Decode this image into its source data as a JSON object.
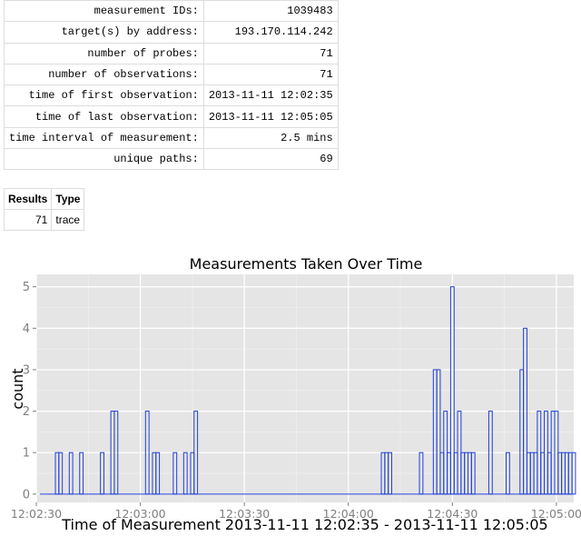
{
  "summary": {
    "rows": [
      {
        "key": "measurement IDs:",
        "value": "1039483"
      },
      {
        "key": "target(s) by address:",
        "value": "193.170.114.242"
      },
      {
        "key": "number of probes:",
        "value": "71"
      },
      {
        "key": "number of observations:",
        "value": "71"
      },
      {
        "key": "time of first observation:",
        "value": "2013-11-11 12:02:35"
      },
      {
        "key": "time of last observation:",
        "value": "2013-11-11 12:05:05"
      },
      {
        "key": "time interval of measurement:",
        "value": "2.5 mins"
      },
      {
        "key": "unique paths:",
        "value": "69"
      }
    ]
  },
  "results": {
    "headers": [
      "Results",
      "Type"
    ],
    "rows": [
      {
        "count": "71",
        "type": "trace"
      }
    ]
  },
  "chart_data": {
    "type": "bar",
    "title": "Measurements Taken Over Time",
    "xlabel": "Time of Measurement 2013-11-11 12:02:35 - 2013-11-11 12:05:05",
    "ylabel": "count",
    "ylim": [
      0,
      5
    ],
    "yticks": [
      0,
      1,
      2,
      3,
      4,
      5
    ],
    "xlim": [
      "12:02:30",
      "12:05:05"
    ],
    "xticks": [
      "12:02:30",
      "12:03:00",
      "12:03:30",
      "12:04:00",
      "12:04:30",
      "12:05:00"
    ],
    "grid": true,
    "bar_color": "#1f3fd6",
    "panel_color": "#e5e5e5",
    "series": [
      {
        "x": [
          "12:02:31.5",
          "12:02:36",
          "12:02:37",
          "12:02:40",
          "12:02:43",
          "12:02:49",
          "12:02:52",
          "12:02:53",
          "12:03:02",
          "12:03:04",
          "12:03:05",
          "12:03:10",
          "12:03:13",
          "12:03:15",
          "12:03:16",
          "12:04:10",
          "12:04:11",
          "12:04:12",
          "12:04:21",
          "12:04:25",
          "12:04:26",
          "12:04:27",
          "12:04:28",
          "12:04:29",
          "12:04:30",
          "12:04:31",
          "12:04:32",
          "12:04:33",
          "12:04:34",
          "12:04:35",
          "12:04:36",
          "12:04:41",
          "12:04:46",
          "12:04:50",
          "12:04:51",
          "12:04:52",
          "12:04:53",
          "12:04:54",
          "12:04:55",
          "12:04:56",
          "12:04:57",
          "12:04:58",
          "12:04:59",
          "12:05:00",
          "12:05:01",
          "12:05:02",
          "12:05:03",
          "12:05:04",
          "12:05:05"
        ],
        "values": [
          0,
          1,
          1,
          1,
          1,
          1,
          2,
          2,
          2,
          1,
          1,
          1,
          1,
          1,
          2,
          1,
          1,
          1,
          1,
          3,
          3,
          1,
          2,
          1,
          5,
          1,
          2,
          1,
          1,
          1,
          1,
          2,
          1,
          3,
          4,
          1,
          1,
          1,
          2,
          1,
          2,
          1,
          2,
          2,
          1,
          1,
          1,
          1,
          1
        ]
      }
    ]
  }
}
